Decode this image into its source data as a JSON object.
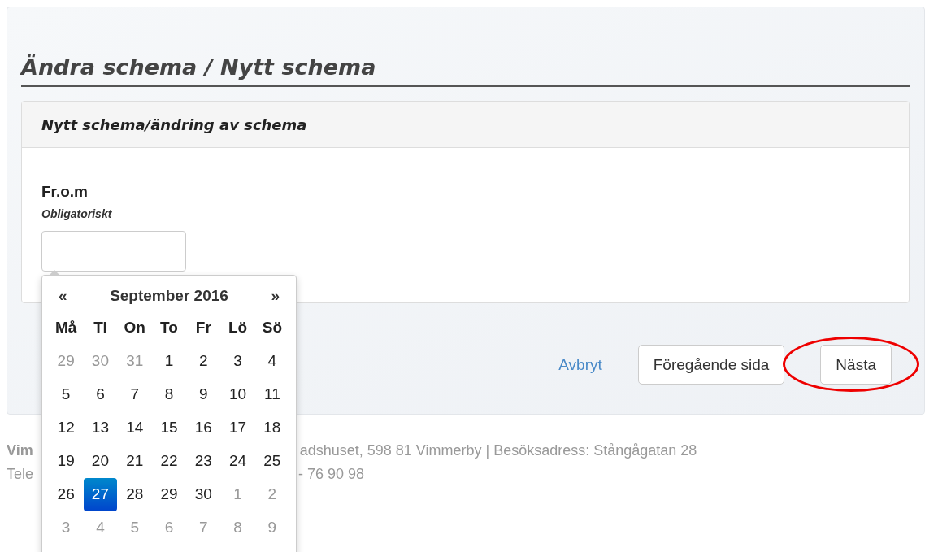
{
  "page_title": "Ändra schema / Nytt schema",
  "card": {
    "title": "Nytt schema/ändring av schema",
    "field": {
      "label": "Fr.o.m",
      "hint": "Obligatoriskt"
    }
  },
  "actions": [
    {
      "kind": "link",
      "label": "Avbryt",
      "annotated": false
    },
    {
      "kind": "button",
      "label": "Föregående sida",
      "annotated": false
    },
    {
      "kind": "button",
      "label": "Nästa",
      "annotated": true
    }
  ],
  "footer": {
    "lines": [
      {
        "left": "Vim",
        "right": "adshuset, 598 81 Vimmerby | Besöksadress: Stångågatan 28"
      },
      {
        "left": "Tele",
        "right": "- 76 90 98"
      }
    ]
  },
  "datepicker": {
    "prev": "«",
    "month": "September 2016",
    "next": "»",
    "weekdays": [
      "Må",
      "Ti",
      "On",
      "To",
      "Fr",
      "Lö",
      "Sö"
    ],
    "weeks": [
      [
        {
          "day": "29",
          "kind": "other",
          "selected": false
        },
        {
          "day": "30",
          "kind": "other",
          "selected": false
        },
        {
          "day": "31",
          "kind": "other",
          "selected": false
        },
        {
          "day": "1",
          "kind": "current",
          "selected": false
        },
        {
          "day": "2",
          "kind": "current",
          "selected": false
        },
        {
          "day": "3",
          "kind": "current",
          "selected": false
        },
        {
          "day": "4",
          "kind": "current",
          "selected": false
        }
      ],
      [
        {
          "day": "5",
          "kind": "current",
          "selected": false
        },
        {
          "day": "6",
          "kind": "current",
          "selected": false
        },
        {
          "day": "7",
          "kind": "current",
          "selected": false
        },
        {
          "day": "8",
          "kind": "current",
          "selected": false
        },
        {
          "day": "9",
          "kind": "current",
          "selected": false
        },
        {
          "day": "10",
          "kind": "current",
          "selected": false
        },
        {
          "day": "11",
          "kind": "current",
          "selected": false
        }
      ],
      [
        {
          "day": "12",
          "kind": "current",
          "selected": false
        },
        {
          "day": "13",
          "kind": "current",
          "selected": false
        },
        {
          "day": "14",
          "kind": "current",
          "selected": false
        },
        {
          "day": "15",
          "kind": "current",
          "selected": false
        },
        {
          "day": "16",
          "kind": "current",
          "selected": false
        },
        {
          "day": "17",
          "kind": "current",
          "selected": false
        },
        {
          "day": "18",
          "kind": "current",
          "selected": false
        }
      ],
      [
        {
          "day": "19",
          "kind": "current",
          "selected": false
        },
        {
          "day": "20",
          "kind": "current",
          "selected": false
        },
        {
          "day": "21",
          "kind": "current",
          "selected": false
        },
        {
          "day": "22",
          "kind": "current",
          "selected": false
        },
        {
          "day": "23",
          "kind": "current",
          "selected": false
        },
        {
          "day": "24",
          "kind": "current",
          "selected": false
        },
        {
          "day": "25",
          "kind": "current",
          "selected": false
        }
      ],
      [
        {
          "day": "26",
          "kind": "current",
          "selected": false
        },
        {
          "day": "27",
          "kind": "current",
          "selected": true
        },
        {
          "day": "28",
          "kind": "current",
          "selected": false
        },
        {
          "day": "29",
          "kind": "current",
          "selected": false
        },
        {
          "day": "30",
          "kind": "current",
          "selected": false
        },
        {
          "day": "1",
          "kind": "other",
          "selected": false
        },
        {
          "day": "2",
          "kind": "other",
          "selected": false
        }
      ],
      [
        {
          "day": "3",
          "kind": "other",
          "selected": false
        },
        {
          "day": "4",
          "kind": "other",
          "selected": false
        },
        {
          "day": "5",
          "kind": "other",
          "selected": false
        },
        {
          "day": "6",
          "kind": "other",
          "selected": false
        },
        {
          "day": "7",
          "kind": "other",
          "selected": false
        },
        {
          "day": "8",
          "kind": "other",
          "selected": false
        },
        {
          "day": "9",
          "kind": "other",
          "selected": false
        }
      ]
    ]
  }
}
